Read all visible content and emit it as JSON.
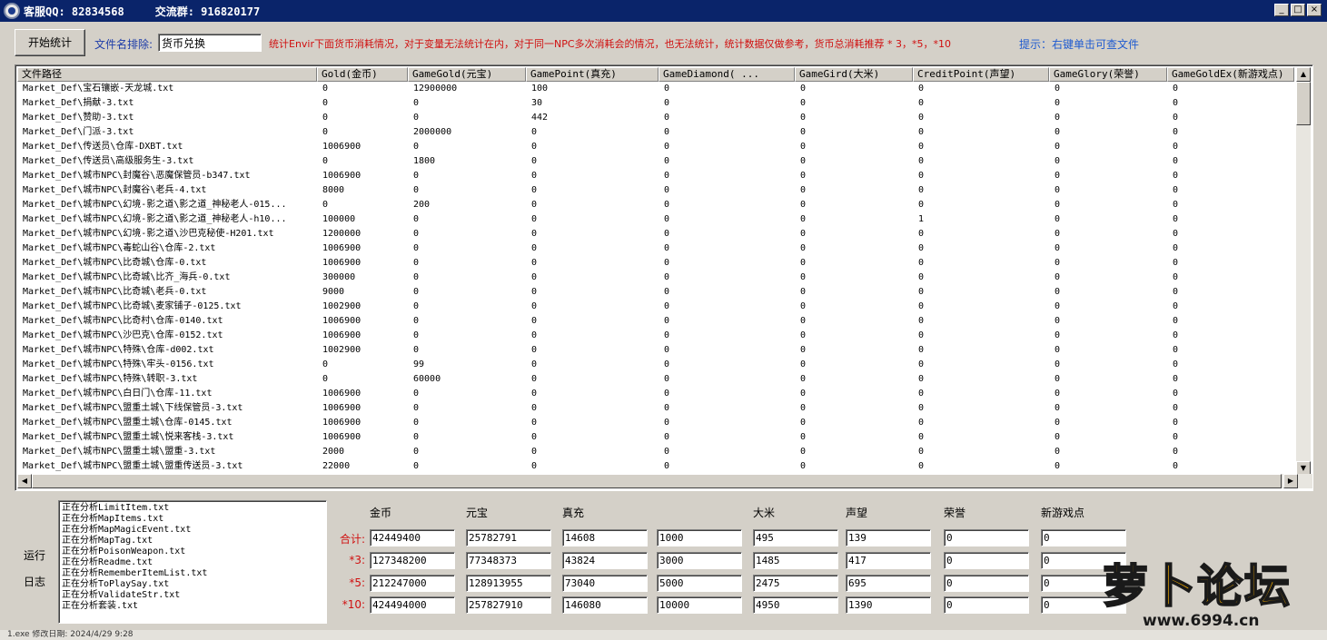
{
  "title_bar": {
    "qq_label": "客服QQ: 82834568",
    "group_label": "交流群: 916820177",
    "minimize_glyph": "_",
    "maximize_glyph": "□",
    "close_glyph": "×"
  },
  "toolbar": {
    "start_button": "开始统计",
    "exclude_label": "文件名排除:",
    "exclude_value": "货币兑换",
    "notice": "统计Envir下面货币消耗情况，对于变量无法统计在内，对于同一NPC多次消耗会的情况，也无法统计，统计数据仅做参考，货币总消耗推荐 * 3，*5，*10",
    "hint": "提示：右键单击可查文件"
  },
  "table": {
    "columns": [
      "文件路径",
      "Gold(金币)",
      "GameGold(元宝)",
      "GamePoint(真充)",
      "GameDiamond(        ...",
      "GameGird(大米)",
      "CreditPoint(声望)",
      "GameGlory(荣誉)",
      "GameGoldEx(新游戏点)"
    ],
    "rows": [
      [
        "Market_Def\\宝石镶嵌-天龙城.txt",
        "0",
        "12900000",
        "100",
        "0",
        "0",
        "0",
        "0",
        "0"
      ],
      [
        "Market_Def\\捐献-3.txt",
        "0",
        "0",
        "30",
        "0",
        "0",
        "0",
        "0",
        "0"
      ],
      [
        "Market_Def\\赞助-3.txt",
        "0",
        "0",
        "442",
        "0",
        "0",
        "0",
        "0",
        "0"
      ],
      [
        "Market_Def\\门派-3.txt",
        "0",
        "2000000",
        "0",
        "0",
        "0",
        "0",
        "0",
        "0"
      ],
      [
        "Market_Def\\传送员\\仓库-DXBT.txt",
        "1006900",
        "0",
        "0",
        "0",
        "0",
        "0",
        "0",
        "0"
      ],
      [
        "Market_Def\\传送员\\高级服务生-3.txt",
        "0",
        "1800",
        "0",
        "0",
        "0",
        "0",
        "0",
        "0"
      ],
      [
        "Market_Def\\城市NPC\\封魔谷\\恶魔保管员-b347.txt",
        "1006900",
        "0",
        "0",
        "0",
        "0",
        "0",
        "0",
        "0"
      ],
      [
        "Market_Def\\城市NPC\\封魔谷\\老兵-4.txt",
        "8000",
        "0",
        "0",
        "0",
        "0",
        "0",
        "0",
        "0"
      ],
      [
        "Market_Def\\城市NPC\\幻境-影之道\\影之道_神秘老人-015...",
        "0",
        "200",
        "0",
        "0",
        "0",
        "0",
        "0",
        "0"
      ],
      [
        "Market_Def\\城市NPC\\幻境-影之道\\影之道_神秘老人-h10...",
        "100000",
        "0",
        "0",
        "0",
        "0",
        "1",
        "0",
        "0"
      ],
      [
        "Market_Def\\城市NPC\\幻境-影之道\\沙巴克秘使-H201.txt",
        "1200000",
        "0",
        "0",
        "0",
        "0",
        "0",
        "0",
        "0"
      ],
      [
        "Market_Def\\城市NPC\\毒蛇山谷\\仓库-2.txt",
        "1006900",
        "0",
        "0",
        "0",
        "0",
        "0",
        "0",
        "0"
      ],
      [
        "Market_Def\\城市NPC\\比奇城\\仓库-0.txt",
        "1006900",
        "0",
        "0",
        "0",
        "0",
        "0",
        "0",
        "0"
      ],
      [
        "Market_Def\\城市NPC\\比奇城\\比齐_海兵-0.txt",
        "300000",
        "0",
        "0",
        "0",
        "0",
        "0",
        "0",
        "0"
      ],
      [
        "Market_Def\\城市NPC\\比奇城\\老兵-0.txt",
        "9000",
        "0",
        "0",
        "0",
        "0",
        "0",
        "0",
        "0"
      ],
      [
        "Market_Def\\城市NPC\\比奇城\\麦家铺子-0125.txt",
        "1002900",
        "0",
        "0",
        "0",
        "0",
        "0",
        "0",
        "0"
      ],
      [
        "Market_Def\\城市NPC\\比奇村\\仓库-0140.txt",
        "1006900",
        "0",
        "0",
        "0",
        "0",
        "0",
        "0",
        "0"
      ],
      [
        "Market_Def\\城市NPC\\沙巴克\\仓库-0152.txt",
        "1006900",
        "0",
        "0",
        "0",
        "0",
        "0",
        "0",
        "0"
      ],
      [
        "Market_Def\\城市NPC\\特殊\\仓库-d002.txt",
        "1002900",
        "0",
        "0",
        "0",
        "0",
        "0",
        "0",
        "0"
      ],
      [
        "Market_Def\\城市NPC\\特殊\\牢头-0156.txt",
        "0",
        "99",
        "0",
        "0",
        "0",
        "0",
        "0",
        "0"
      ],
      [
        "Market_Def\\城市NPC\\特殊\\转职-3.txt",
        "0",
        "60000",
        "0",
        "0",
        "0",
        "0",
        "0",
        "0"
      ],
      [
        "Market_Def\\城市NPC\\白日门\\仓库-11.txt",
        "1006900",
        "0",
        "0",
        "0",
        "0",
        "0",
        "0",
        "0"
      ],
      [
        "Market_Def\\城市NPC\\盟重土城\\下线保管员-3.txt",
        "1006900",
        "0",
        "0",
        "0",
        "0",
        "0",
        "0",
        "0"
      ],
      [
        "Market_Def\\城市NPC\\盟重土城\\仓库-0145.txt",
        "1006900",
        "0",
        "0",
        "0",
        "0",
        "0",
        "0",
        "0"
      ],
      [
        "Market_Def\\城市NPC\\盟重土城\\悦来客栈-3.txt",
        "1006900",
        "0",
        "0",
        "0",
        "0",
        "0",
        "0",
        "0"
      ],
      [
        "Market_Def\\城市NPC\\盟重土城\\盟重-3.txt",
        "2000",
        "0",
        "0",
        "0",
        "0",
        "0",
        "0",
        "0"
      ],
      [
        "Market_Def\\城市NPC\\盟重土城\\盟重传送员-3.txt",
        "22000",
        "0",
        "0",
        "0",
        "0",
        "0",
        "0",
        "0"
      ]
    ],
    "scroll_up_glyph": "▲",
    "scroll_down_glyph": "▼",
    "scroll_left_glyph": "◀",
    "scroll_right_glyph": "▶"
  },
  "log": {
    "label_top": "运行",
    "label_bottom": "日志",
    "lines": [
      "正在分析LimitItem.txt",
      "正在分析MapItems.txt",
      "正在分析MapMagicEvent.txt",
      "正在分析MapTag.txt",
      "正在分析PoisonWeapon.txt",
      "正在分析Readme.txt",
      "正在分析RememberItemList.txt",
      "正在分析ToPlaySay.txt",
      "正在分析ValidateStr.txt",
      "正在分析套装.txt"
    ]
  },
  "summary": {
    "headers": [
      "金币",
      "元宝",
      "真充",
      "",
      "大米",
      "声望",
      "荣誉",
      "新游戏点"
    ],
    "rows": [
      {
        "label": "合计:",
        "values": [
          "42449400",
          "25782791",
          "14608",
          "1000",
          "495",
          "139",
          "0",
          "0"
        ]
      },
      {
        "label": "*3:",
        "values": [
          "127348200",
          "77348373",
          "43824",
          "3000",
          "1485",
          "417",
          "0",
          "0"
        ]
      },
      {
        "label": "*5:",
        "values": [
          "212247000",
          "128913955",
          "73040",
          "5000",
          "2475",
          "695",
          "0",
          "0"
        ]
      },
      {
        "label": "*10:",
        "values": [
          "424494000",
          "257827910",
          "146080",
          "10000",
          "4950",
          "1390",
          "0",
          "0"
        ]
      }
    ]
  },
  "watermark": {
    "title": "萝卜论坛",
    "url": "www.6994.cn"
  },
  "status_bar": {
    "text": "1.exe  修改日期: 2024/4/29 9:28"
  },
  "colors": {
    "title_bar": "#0a246a",
    "window_face": "#d4d0c8",
    "notice_red": "#d01010",
    "hint_blue": "#1f5bd0",
    "label_blue": "#1d3ca8",
    "watermark_orange": "#ffb400"
  }
}
